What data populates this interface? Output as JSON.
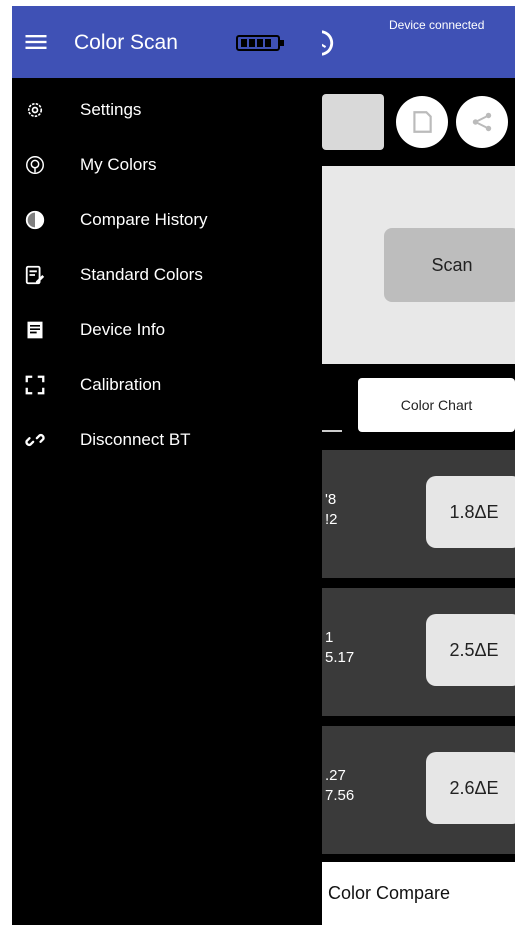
{
  "app_title": "Color Scan",
  "device_status": "Device connected",
  "drawer": {
    "items": [
      {
        "label": "Settings",
        "icon": "gear-icon"
      },
      {
        "label": "My Colors",
        "icon": "palette-icon"
      },
      {
        "label": "Compare History",
        "icon": "contrast-icon"
      },
      {
        "label": "Standard Colors",
        "icon": "edit-note-icon"
      },
      {
        "label": "Device Info",
        "icon": "document-icon"
      },
      {
        "label": "Calibration",
        "icon": "corners-icon"
      },
      {
        "label": "Disconnect BT",
        "icon": "link-icon"
      }
    ]
  },
  "main": {
    "scan_label": "Scan",
    "color_chart_label": "Color Chart",
    "results": [
      {
        "line1": "'8",
        "line2": "!2",
        "delta": "1.8ΔE"
      },
      {
        "line1": "1",
        "line2": "5.17",
        "delta": "2.5ΔE"
      },
      {
        "line1": ".27",
        "line2": "7.56",
        "delta": "2.6ΔE"
      }
    ],
    "compare_label": "Color Compare"
  },
  "colors": {
    "toolbar": "#3f51b5",
    "drawer_bg": "#000000",
    "result_card": "#3a3a3a"
  }
}
